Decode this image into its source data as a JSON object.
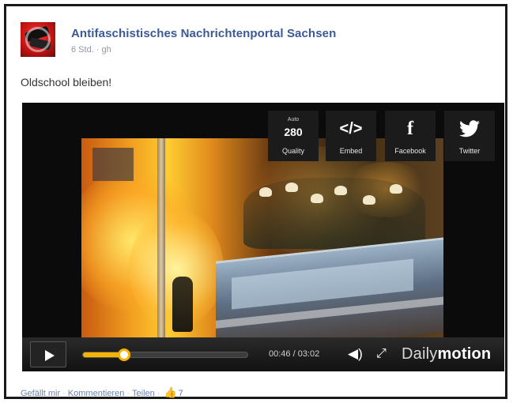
{
  "post": {
    "page_name": "Antifaschistisches Nachrichtenportal Sachsen",
    "meta": "6 Std. · gh",
    "text": "Oldschool bleiben!"
  },
  "video": {
    "overlay_buttons": [
      {
        "id": "quality",
        "small": "Auto",
        "value": "280",
        "label": "Quality",
        "icon": "quality-icon"
      },
      {
        "id": "embed",
        "value": "</>",
        "label": "Embed",
        "icon": "embed-icon"
      },
      {
        "id": "facebook",
        "value": "f",
        "label": "Facebook",
        "icon": "facebook-icon"
      },
      {
        "id": "twitter",
        "value": "🐦",
        "label": "Twitter",
        "icon": "twitter-icon"
      }
    ],
    "controls": {
      "time": "00:46 / 03:02",
      "progress_fraction": 0.25,
      "brand_prefix": "Daily",
      "brand_suffix": "motion"
    },
    "accent_color": "#f6b400"
  },
  "actions": {
    "like": "Gefällt mir",
    "comment": "Kommentieren",
    "share": "Teilen",
    "like_count": "7"
  }
}
